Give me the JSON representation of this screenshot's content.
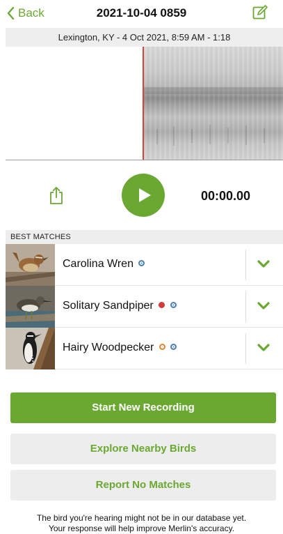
{
  "nav": {
    "back_label": "Back",
    "title": "2021-10-04 0859"
  },
  "recording": {
    "location_line": "Lexington, KY - 4 Oct 2021, 8:59 AM - 1:18",
    "timer": "00:00.00"
  },
  "matches": {
    "header": "BEST MATCHES",
    "items": [
      {
        "name": "Carolina Wren",
        "badges": [
          "verified"
        ]
      },
      {
        "name": "Solitary Sandpiper",
        "badges": [
          "red",
          "verified"
        ]
      },
      {
        "name": "Hairy Woodpecker",
        "badges": [
          "orange",
          "verified"
        ]
      }
    ]
  },
  "buttons": {
    "start_new": "Start New Recording",
    "explore": "Explore Nearby Birds",
    "report": "Report No Matches"
  },
  "footer": {
    "line1": "The bird you're hearing might not be in our database yet.",
    "line2": "Your response will help improve Merlin's accuracy."
  },
  "colors": {
    "accent": "#6aa832",
    "playhead": "#d9433d",
    "verified": "#4d7fb3"
  },
  "icons": {
    "back": "chevron-left-icon",
    "edit": "edit-icon",
    "share": "share-icon",
    "play": "play-icon",
    "expand": "chevron-down-icon"
  }
}
